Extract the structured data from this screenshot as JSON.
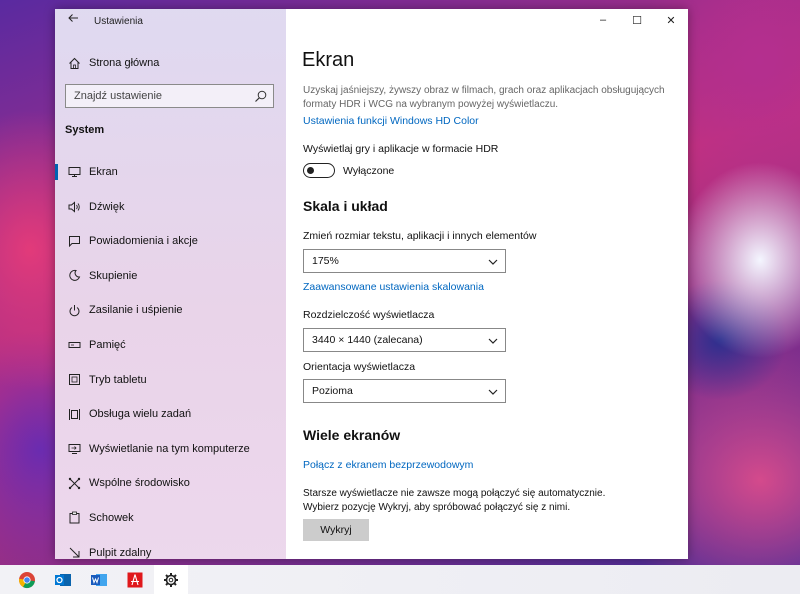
{
  "window": {
    "app_title": "Ustawienia",
    "controls": {
      "minimize": "–",
      "maximize": "☐",
      "close": "✕"
    }
  },
  "sidebar": {
    "home_label": "Strona główna",
    "search_placeholder": "Znajdź ustawienie",
    "section_header": "System",
    "items": [
      {
        "label": "Ekran",
        "icon": "monitor-icon",
        "selected": true
      },
      {
        "label": "Dźwięk",
        "icon": "speaker-icon"
      },
      {
        "label": "Powiadomienia i akcje",
        "icon": "notification-icon"
      },
      {
        "label": "Skupienie",
        "icon": "moon-icon"
      },
      {
        "label": "Zasilanie i uśpienie",
        "icon": "power-icon"
      },
      {
        "label": "Pamięć",
        "icon": "storage-icon"
      },
      {
        "label": "Tryb tabletu",
        "icon": "tablet-icon"
      },
      {
        "label": "Obsługa wielu zadań",
        "icon": "multitasking-icon"
      },
      {
        "label": "Wyświetlanie na tym komputerze",
        "icon": "projecting-icon"
      },
      {
        "label": "Wspólne środowisko",
        "icon": "shared-experiences-icon"
      },
      {
        "label": "Schowek",
        "icon": "clipboard-icon"
      },
      {
        "label": "Pulpit zdalny",
        "icon": "remote-desktop-icon"
      }
    ]
  },
  "content": {
    "title": "Ekran",
    "hdr_description": "Uzyskaj jaśniejszy, żywszy obraz w filmach, grach oraz aplikacjach obsługujących formaty HDR i WCG na wybranym powyżej wyświetlaczu.",
    "hdr_link": "Ustawienia funkcji Windows HD Color",
    "hdr_toggle_label": "Wyświetlaj gry i aplikacje w formacie HDR",
    "hdr_toggle_state": "Wyłączone",
    "scale_header": "Skala i układ",
    "scale_label": "Zmień rozmiar tekstu, aplikacji i innych elementów",
    "scale_value": "175%",
    "scale_link": "Zaawansowane ustawienia skalowania",
    "resolution_label": "Rozdzielczość wyświetlacza",
    "resolution_value": "3440 × 1440 (zalecana)",
    "orientation_label": "Orientacja wyświetlacza",
    "orientation_value": "Pozioma",
    "multi_header": "Wiele ekranów",
    "wireless_link": "Połącz z ekranem bezprzewodowym",
    "multi_text_1": "Starsze wyświetlacze nie zawsze mogą połączyć się automatycznie.",
    "multi_text_2": "Wybierz pozycję Wykryj, aby spróbować połączyć się z nimi.",
    "detect_button": "Wykryj"
  },
  "taskbar": {
    "apps": [
      "chrome-icon",
      "outlook-icon",
      "word-icon",
      "acrobat-icon",
      "settings-gear-icon"
    ],
    "active": "settings-gear-icon"
  },
  "colors": {
    "accent": "#0067c0",
    "selection_bar": "#0063b1"
  }
}
